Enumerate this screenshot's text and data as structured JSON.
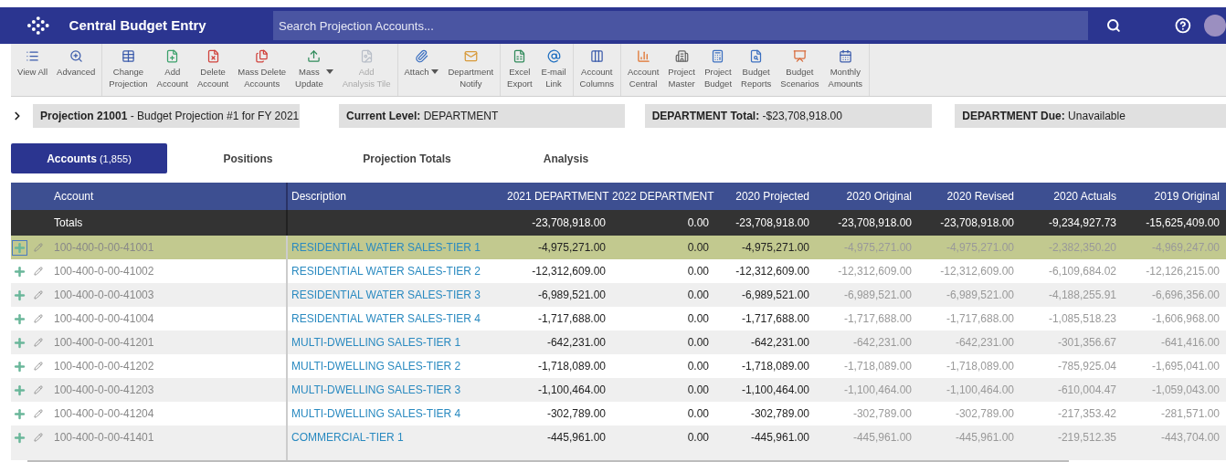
{
  "header": {
    "title": "Central Budget Entry",
    "search": {
      "placeholder": "Search Projection Accounts..."
    }
  },
  "toolbar": {
    "groups": [
      [
        {
          "label": "View All",
          "disabled": false,
          "dropdown": false
        },
        {
          "label": "Advanced",
          "disabled": false,
          "dropdown": false
        }
      ],
      [
        {
          "label": "Change\nProjection",
          "disabled": false,
          "dropdown": false
        },
        {
          "label": "Add\nAccount",
          "disabled": false,
          "dropdown": false
        },
        {
          "label": "Delete\nAccount",
          "disabled": false,
          "dropdown": false
        },
        {
          "label": "Mass Delete\nAccounts",
          "disabled": false,
          "dropdown": false
        },
        {
          "label": "Mass\nUpdate",
          "disabled": false,
          "dropdown": true
        },
        {
          "label": "Add\nAnalysis Tile",
          "disabled": true,
          "dropdown": false
        }
      ],
      [
        {
          "label": "Attach",
          "disabled": false,
          "dropdown": true
        },
        {
          "label": "Department\nNotify",
          "disabled": false,
          "dropdown": false
        }
      ],
      [
        {
          "label": "Excel\nExport",
          "disabled": false,
          "dropdown": false
        },
        {
          "label": "E-mail\nLink",
          "disabled": false,
          "dropdown": false
        }
      ],
      [
        {
          "label": "Account\nColumns",
          "disabled": false,
          "dropdown": false
        }
      ],
      [
        {
          "label": "Account\nCentral",
          "disabled": false,
          "dropdown": false
        },
        {
          "label": "Project\nMaster",
          "disabled": false,
          "dropdown": false
        },
        {
          "label": "Project\nBudget",
          "disabled": false,
          "dropdown": false
        },
        {
          "label": "Budget\nReports",
          "disabled": false,
          "dropdown": false
        },
        {
          "label": "Budget\nScenarios",
          "disabled": false,
          "dropdown": false
        },
        {
          "label": "Monthly\nAmounts",
          "disabled": false,
          "dropdown": false
        }
      ]
    ]
  },
  "info_bar": [
    {
      "label": "Projection 21001",
      "value": " - Budget Projection #1 for FY 2021"
    },
    {
      "label": "Current Level:",
      "value": "DEPARTMENT"
    },
    {
      "label": "DEPARTMENT Total:",
      "value": "-$23,708,918.00"
    },
    {
      "label": "DEPARTMENT Due:",
      "value": "Unavailable"
    }
  ],
  "tabs": [
    {
      "label": "Accounts",
      "count": "(1,855)",
      "selected": true
    },
    {
      "label": "Positions",
      "selected": false
    },
    {
      "label": "Projection Totals",
      "selected": false
    },
    {
      "label": "Analysis",
      "selected": false
    }
  ],
  "table": {
    "columns": [
      {
        "label": "Account"
      },
      {
        "label": "Description"
      },
      {
        "label": "2021 DEPARTMENT",
        "muted": false
      },
      {
        "label": "2022 DEPARTMENT",
        "muted": false
      },
      {
        "label": "2020 Projected",
        "muted": false
      },
      {
        "label": "2020 Original",
        "muted": true
      },
      {
        "label": "2020 Revised",
        "muted": true
      },
      {
        "label": "2020 Actuals",
        "muted": true
      },
      {
        "label": "2019 Original",
        "muted": true
      }
    ],
    "totals": {
      "label": "Totals",
      "values": [
        "-23,708,918.00",
        "0.00",
        "-23,708,918.00",
        "-23,708,918.00",
        "-23,708,918.00",
        "-9,234,927.73",
        "-15,625,409.00"
      ]
    },
    "rows": [
      {
        "account": "100-400-0-00-41001",
        "description": "RESIDENTIAL WATER SALES-TIER 1",
        "selected": true,
        "values": [
          "-4,975,271.00",
          "0.00",
          "-4,975,271.00",
          "-4,975,271.00",
          "-4,975,271.00",
          "-2,382,350.20",
          "-4,969,247.00"
        ]
      },
      {
        "account": "100-400-0-00-41002",
        "description": "RESIDENTIAL WATER SALES-TIER 2",
        "selected": false,
        "values": [
          "-12,312,609.00",
          "0.00",
          "-12,312,609.00",
          "-12,312,609.00",
          "-12,312,609.00",
          "-6,109,684.02",
          "-12,126,215.00"
        ]
      },
      {
        "account": "100-400-0-00-41003",
        "description": "RESIDENTIAL WATER SALES-TIER 3",
        "selected": false,
        "values": [
          "-6,989,521.00",
          "0.00",
          "-6,989,521.00",
          "-6,989,521.00",
          "-6,989,521.00",
          "-4,188,255.91",
          "-6,696,356.00"
        ]
      },
      {
        "account": "100-400-0-00-41004",
        "description": "RESIDENTIAL WATER SALES-TIER 4",
        "selected": false,
        "values": [
          "-1,717,688.00",
          "0.00",
          "-1,717,688.00",
          "-1,717,688.00",
          "-1,717,688.00",
          "-1,085,518.23",
          "-1,606,968.00"
        ]
      },
      {
        "account": "100-400-0-00-41201",
        "description": "MULTI-DWELLING SALES-TIER 1",
        "selected": false,
        "values": [
          "-642,231.00",
          "0.00",
          "-642,231.00",
          "-642,231.00",
          "-642,231.00",
          "-301,356.67",
          "-641,416.00"
        ]
      },
      {
        "account": "100-400-0-00-41202",
        "description": "MULTI-DWELLING SALES-TIER 2",
        "selected": false,
        "values": [
          "-1,718,089.00",
          "0.00",
          "-1,718,089.00",
          "-1,718,089.00",
          "-1,718,089.00",
          "-785,925.04",
          "-1,695,041.00"
        ]
      },
      {
        "account": "100-400-0-00-41203",
        "description": "MULTI-DWELLING SALES-TIER 3",
        "selected": false,
        "values": [
          "-1,100,464.00",
          "0.00",
          "-1,100,464.00",
          "-1,100,464.00",
          "-1,100,464.00",
          "-610,004.47",
          "-1,059,043.00"
        ]
      },
      {
        "account": "100-400-0-00-41204",
        "description": "MULTI-DWELLING SALES-TIER 4",
        "selected": false,
        "values": [
          "-302,789.00",
          "0.00",
          "-302,789.00",
          "-302,789.00",
          "-302,789.00",
          "-217,353.42",
          "-281,571.00"
        ]
      },
      {
        "account": "100-400-0-00-41401",
        "description": "COMMERCIAL-TIER 1",
        "selected": false,
        "values": [
          "-445,961.00",
          "0.00",
          "-445,961.00",
          "-445,961.00",
          "-445,961.00",
          "-219,512.35",
          "-443,704.00"
        ]
      }
    ]
  }
}
